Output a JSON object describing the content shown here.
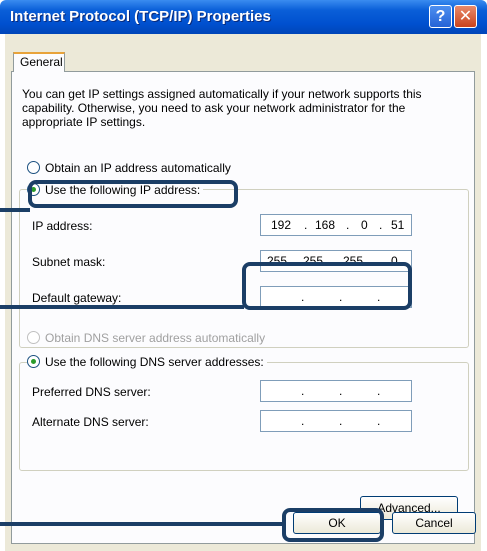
{
  "window": {
    "title": "Internet Protocol (TCP/IP) Properties",
    "help_label": "?",
    "close_label": "✕"
  },
  "tabs": [
    {
      "label": "General"
    }
  ],
  "description": "You can get IP settings assigned automatically if your network supports this capability. Otherwise, you need to ask your network administrator for the appropriate IP settings.",
  "ip_mode": {
    "auto_label": "Obtain an IP address automatically",
    "manual_label": "Use the following IP address:",
    "selected": "manual"
  },
  "ip_fields": {
    "ip_label": "IP address:",
    "ip_value": [
      "192",
      "168",
      "0",
      "51"
    ],
    "subnet_label": "Subnet mask:",
    "subnet_value": [
      "255",
      "255",
      "255",
      "0"
    ],
    "gateway_label": "Default gateway:"
  },
  "dns_mode": {
    "auto_label": "Obtain DNS server address automatically",
    "manual_label": "Use the following DNS server addresses:",
    "selected": "manual"
  },
  "dns_fields": {
    "preferred_label": "Preferred DNS server:",
    "alternate_label": "Alternate DNS server:"
  },
  "buttons": {
    "advanced": "Advanced...",
    "ok": "OK",
    "cancel": "Cancel"
  },
  "colors": {
    "titlebar": "#0054e3",
    "callout": "#1b3e66",
    "selected_radio": "#2a9b2a"
  }
}
